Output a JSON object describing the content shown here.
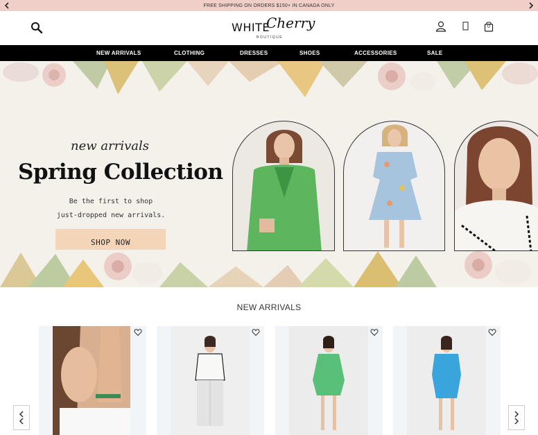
{
  "announcement": {
    "text": "FREE SHIPPING ON ORDERS $150+ IN CANADA ONLY",
    "prev_icon": "chevron-left-icon",
    "next_icon": "chevron-right-icon"
  },
  "header": {
    "logo": {
      "word1": "WHITE",
      "word2": "Cherry",
      "word3": "BOUTIQUE"
    },
    "icons": [
      "search-icon",
      "account-icon",
      "wishlist-icon",
      "shopping-bag-icon"
    ],
    "cart_count": "0"
  },
  "nav": {
    "items": [
      {
        "label": "NEW ARRIVALS"
      },
      {
        "label": "CLOTHING"
      },
      {
        "label": "DRESSES"
      },
      {
        "label": "SHOES"
      },
      {
        "label": "ACCESSORIES"
      },
      {
        "label": "SALE"
      }
    ]
  },
  "hero": {
    "eyebrow": "new arrivals",
    "title": "Spring Collection",
    "subtitle_line1": "Be the first to shop",
    "subtitle_line2": "just-dropped new arrivals.",
    "cta": "SHOP NOW"
  },
  "new_arrivals": {
    "title": "NEW ARRIVALS",
    "prev_icon": "chevron-left-icon",
    "next_icon": "chevron-right-icon"
  },
  "colors": {
    "announcement_bg": "#f1cfc9",
    "nav_bg": "#000000",
    "cta_bg": "#f4d5b8",
    "hero_bg": "#f4f0ea"
  }
}
